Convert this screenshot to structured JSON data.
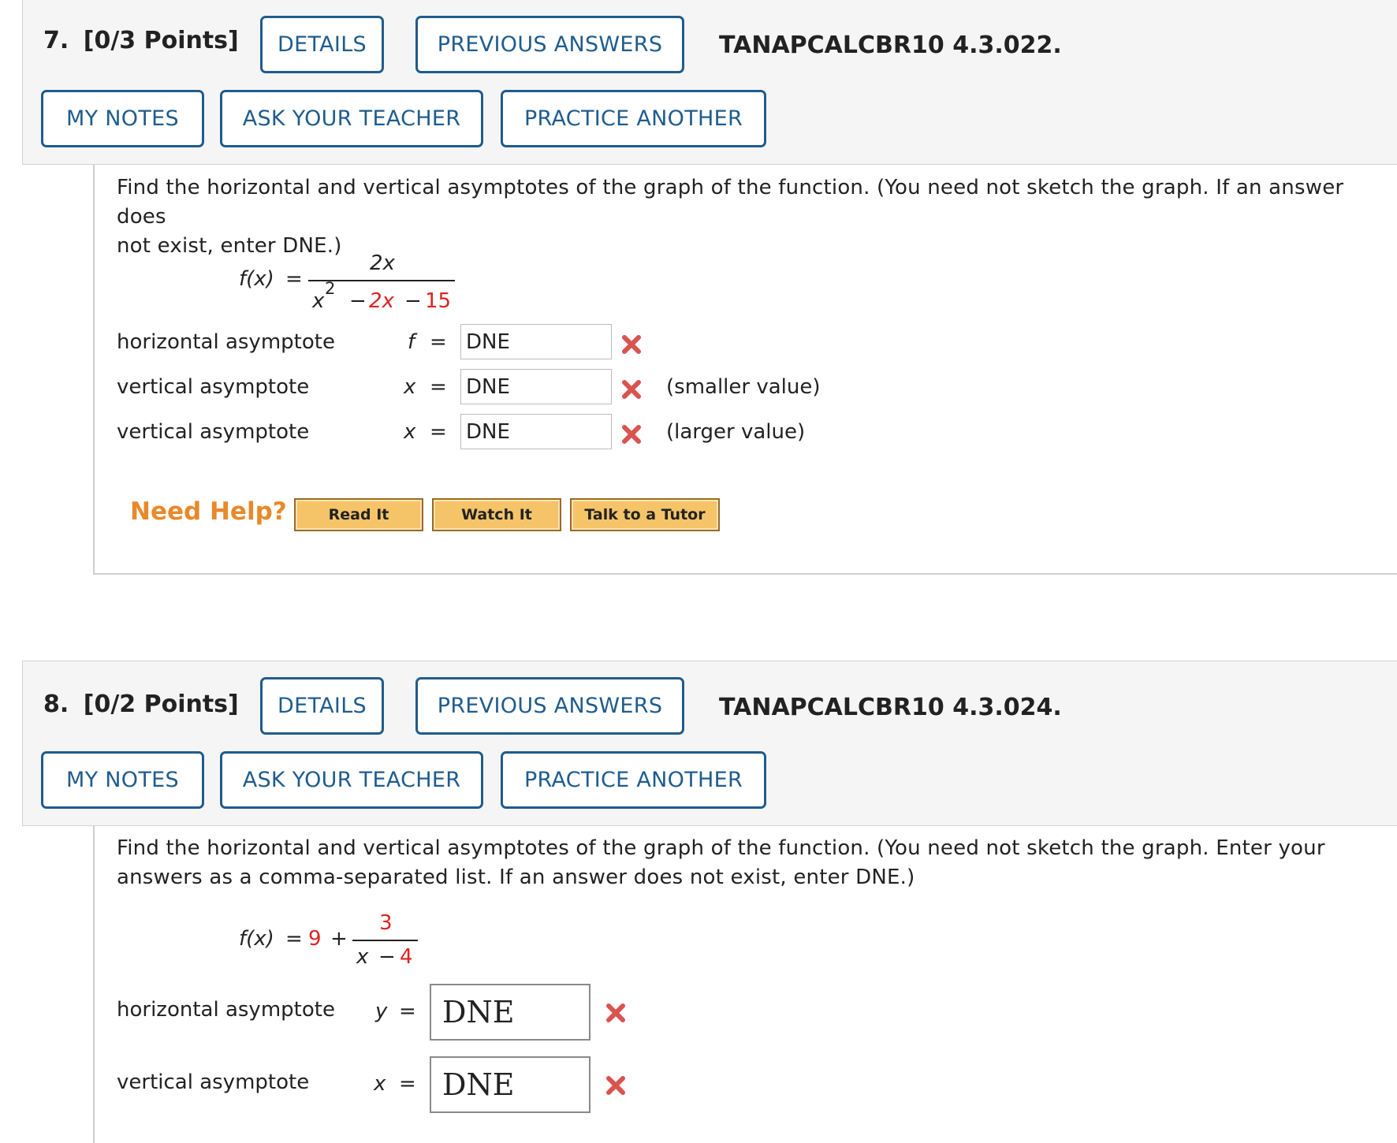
{
  "q7": {
    "number": "7.",
    "points": "[0/3 Points]",
    "buttons": {
      "details": "DETAILS",
      "previous_answers": "PREVIOUS ANSWERS",
      "my_notes": "MY NOTES",
      "ask_teacher": "ASK YOUR TEACHER",
      "practice_another": "PRACTICE ANOTHER"
    },
    "problem_id": "TANAPCALCBR10 4.3.022.",
    "prompt_line1": "Find the horizontal and vertical asymptotes of the graph of the function. (You need not sketch the graph. If an answer does",
    "prompt_line2": "not exist, enter DNE.)",
    "function": {
      "lhs": "f(x)",
      "eq": "=",
      "numerator": "2x",
      "den_x": "x",
      "den_exp": "2",
      "den_minus1": "−",
      "den_coef": "2x",
      "den_minus2": "−",
      "den_const": "15"
    },
    "rows": [
      {
        "label": "horizontal asymptote",
        "var": "f",
        "eq": "=",
        "value": "DNE",
        "status": "incorrect",
        "note": ""
      },
      {
        "label": "vertical asymptote",
        "var": "x",
        "eq": "=",
        "value": "DNE",
        "status": "incorrect",
        "note": "(smaller value)"
      },
      {
        "label": "vertical asymptote",
        "var": "x",
        "eq": "=",
        "value": "DNE",
        "status": "incorrect",
        "note": "(larger value)"
      }
    ],
    "help": {
      "label": "Need Help?",
      "read_it": "Read It",
      "watch_it": "Watch It",
      "talk_tutor": "Talk to a Tutor"
    }
  },
  "q8": {
    "number": "8.",
    "points": "[0/2 Points]",
    "buttons": {
      "details": "DETAILS",
      "previous_answers": "PREVIOUS ANSWERS",
      "my_notes": "MY NOTES",
      "ask_teacher": "ASK YOUR TEACHER",
      "practice_another": "PRACTICE ANOTHER"
    },
    "problem_id": "TANAPCALCBR10 4.3.024.",
    "prompt_line1": "Find the horizontal and vertical asymptotes of the graph of the function. (You need not sketch the graph. Enter your",
    "prompt_line2": "answers as a comma-separated list. If an answer does not exist, enter DNE.)",
    "function": {
      "lhs": "f(x)",
      "eq": "=",
      "const": "9",
      "plus": "+",
      "numerator": "3",
      "den_x": "x",
      "den_minus": "−",
      "den_const": "4"
    },
    "rows": [
      {
        "label": "horizontal asymptote",
        "var": "y",
        "eq": "=",
        "value": "DNE",
        "status": "incorrect"
      },
      {
        "label": "vertical asymptote",
        "var": "x",
        "eq": "=",
        "value": "DNE",
        "status": "incorrect"
      }
    ]
  },
  "colors": {
    "link_blue": "#1f5c8d",
    "incorrect_red": "#d9534f",
    "highlight_red": "#dd2222",
    "help_orange": "#e8892a",
    "help_button": "#f5c469"
  },
  "icons": {
    "incorrect": "x-mark-icon"
  }
}
